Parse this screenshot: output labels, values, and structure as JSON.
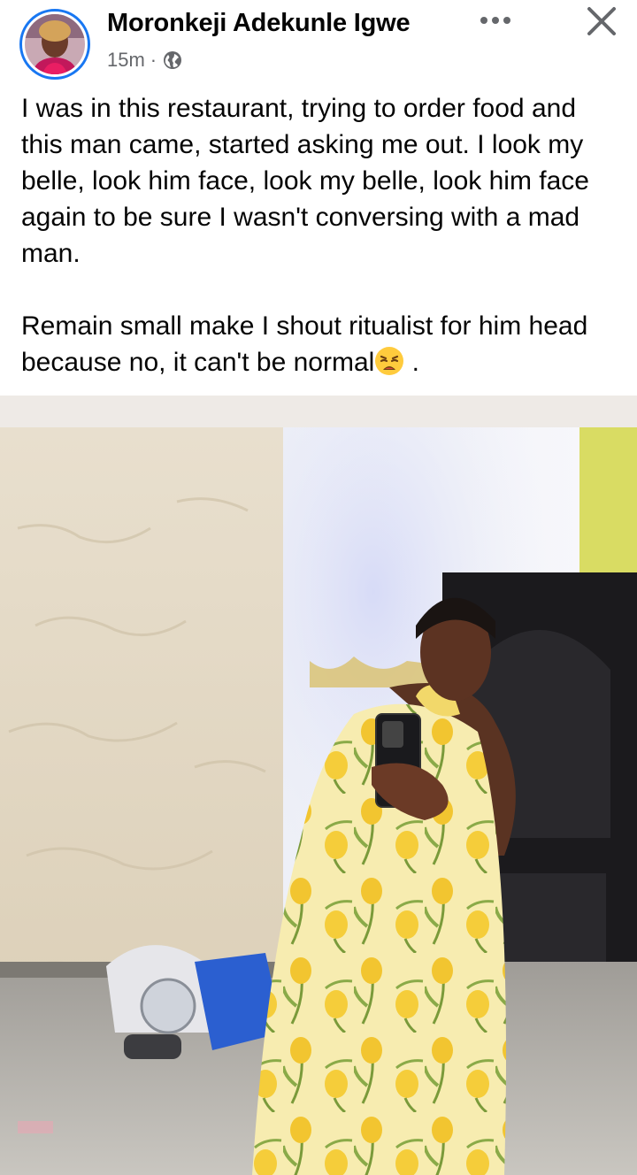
{
  "post": {
    "author": "Moronkeji Adekunle Igwe",
    "time": "15m",
    "separator": "·",
    "audience_icon": "globe-icon",
    "more_icon": "more-dots-icon",
    "close_icon": "close-icon",
    "paragraphs": [
      "I was in this restaurant, trying to order food and this man came, started asking me out. I look my belle, look him face, look my belle, look him face again to be sure I wasn't conversing with a mad man.",
      "Remain small make I shout ritualist for him head because no, it can't be normal"
    ],
    "paragraph_end": " .",
    "emoji": "weary-face-emoji"
  },
  "colors": {
    "accent": "#1877f2",
    "meta": "#65676b",
    "text": "#050505"
  }
}
